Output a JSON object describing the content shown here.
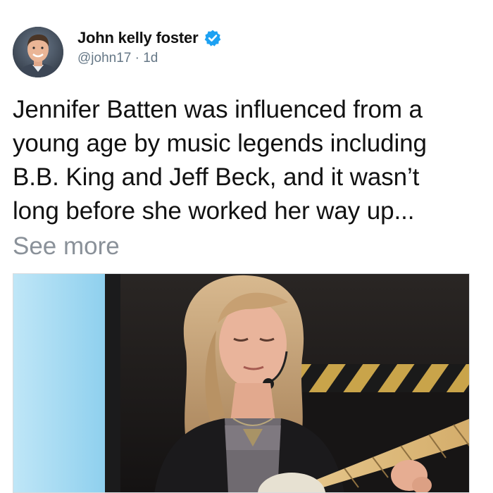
{
  "tweet": {
    "author": {
      "display_name": "John kelly foster",
      "handle": "@john17",
      "separator": " · ",
      "time_ago": "1d",
      "verified": true,
      "avatar_icon": "profile-photo"
    },
    "text_lines": [
      "Jennifer Batten was influenced from a",
      "young age by music legends including",
      "B.B. King and Jeff Beck, and it wasn’t",
      "long before she worked her way up..."
    ],
    "see_more_label": "See more",
    "media": {
      "kind": "photo",
      "subject_icon": "guitarist-photo"
    }
  },
  "colors": {
    "verified_badge": "#1da1f2",
    "secondary_text": "#657786",
    "see_more": "#8a9199"
  }
}
